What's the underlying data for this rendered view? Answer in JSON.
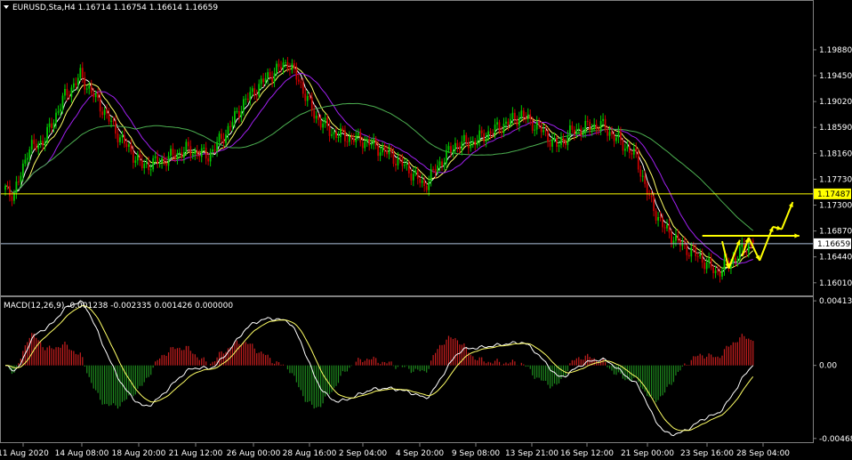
{
  "header": {
    "symbol_line": "EURUSD,Sta,H4  1.16714 1.16754 1.16614 1.16659",
    "macd_line": "MACD(12,26,9) -0.001238 -0.002335 0.001426 0.000000"
  },
  "colors": {
    "background": "#000000",
    "bull_candle": "#00c800",
    "bear_candle": "#c80000",
    "ma_fast": "#ffffff",
    "ma_mid": "#ffff66",
    "ma_slow": "#a020f0",
    "ma_long": "#4caf50",
    "level_line": "#ffff00",
    "price_line": "#b0c4de",
    "macd_pos": "#c81e1e",
    "macd_neg": "#1e8c1e",
    "macd_main": "#ffffff",
    "macd_signal": "#ffff66",
    "annotation": "#ffff00"
  },
  "chart_data": [
    {
      "type": "candlestick",
      "panel": "price",
      "ylim": [
        1.1583,
        1.205
      ],
      "y_ticks": [
        1.1988,
        1.1945,
        1.1902,
        1.1859,
        1.1816,
        1.1773,
        1.173,
        1.1687,
        1.1644,
        1.1601
      ],
      "y_tick_labels": [
        "1.19880",
        "1.19450",
        "1.19020",
        "1.18590",
        "1.18160",
        "1.17730",
        "1.17300",
        "1.16870",
        "1.16440",
        "1.16010"
      ],
      "level_price": 1.17487,
      "level_label": "1.17487",
      "current_price": 1.16659,
      "current_label": "1.16659",
      "x_labels": [
        "11 Aug 2020",
        "14 Aug 08:00",
        "18 Aug 20:00",
        "21 Aug 12:00",
        "26 Aug 00:00",
        "28 Aug 16:00",
        "2 Sep 04:00",
        "4 Sep 20:00",
        "9 Sep 08:00",
        "13 Sep 21:00",
        "16 Sep 12:00",
        "21 Sep 00:00",
        "23 Sep 16:00",
        "28 Sep 04:00"
      ],
      "anchors": [
        [
          0,
          1.176
        ],
        [
          4,
          1.1745
        ],
        [
          10,
          1.182
        ],
        [
          18,
          1.184
        ],
        [
          26,
          1.1905
        ],
        [
          34,
          1.1945
        ],
        [
          44,
          1.189
        ],
        [
          52,
          1.1842
        ],
        [
          62,
          1.1795
        ],
        [
          72,
          1.1805
        ],
        [
          82,
          1.1822
        ],
        [
          92,
          1.1812
        ],
        [
          100,
          1.185
        ],
        [
          108,
          1.19
        ],
        [
          118,
          1.194
        ],
        [
          128,
          1.1968
        ],
        [
          134,
          1.193
        ],
        [
          140,
          1.188
        ],
        [
          148,
          1.185
        ],
        [
          156,
          1.1842
        ],
        [
          164,
          1.1835
        ],
        [
          174,
          1.1815
        ],
        [
          182,
          1.1792
        ],
        [
          190,
          1.1762
        ],
        [
          196,
          1.1795
        ],
        [
          204,
          1.183
        ],
        [
          212,
          1.1835
        ],
        [
          222,
          1.1855
        ],
        [
          234,
          1.188
        ],
        [
          242,
          1.1858
        ],
        [
          250,
          1.1828
        ],
        [
          256,
          1.185
        ],
        [
          262,
          1.1858
        ],
        [
          270,
          1.1863
        ],
        [
          278,
          1.1838
        ],
        [
          286,
          1.181
        ],
        [
          292,
          1.174
        ],
        [
          298,
          1.1695
        ],
        [
          306,
          1.1665
        ],
        [
          316,
          1.164
        ],
        [
          322,
          1.1618
        ],
        [
          328,
          1.1632
        ],
        [
          334,
          1.1655
        ],
        [
          339,
          1.1666
        ]
      ],
      "ma_periods": [
        5,
        10,
        20,
        60
      ],
      "arrows": [
        [
          [
            325,
            1.167
          ],
          [
            328,
            1.1625
          ]
        ],
        [
          [
            328,
            1.1625
          ],
          [
            333,
            1.1672
          ]
        ],
        [
          [
            334,
            1.1645
          ],
          [
            337,
            1.1676
          ]
        ],
        [
          [
            337,
            1.1676
          ],
          [
            342,
            1.1638
          ]
        ],
        [
          [
            342,
            1.1638
          ],
          [
            348,
            1.1694
          ]
        ],
        [
          [
            348,
            1.1694
          ],
          [
            352,
            1.169
          ]
        ],
        [
          [
            352,
            1.169
          ],
          [
            357,
            1.1735
          ]
        ]
      ],
      "hline_annotation": [
        [
          316,
          1.1679
        ],
        [
          360,
          1.1679
        ]
      ]
    },
    {
      "type": "macd",
      "panel": "indicator",
      "params": [
        12,
        26,
        9
      ],
      "ylim": [
        -0.00475,
        0.0042
      ],
      "y_ticks": [
        0.004136,
        0.0,
        -0.004681
      ],
      "y_tick_labels": [
        "0.004136",
        "0.00",
        "-0.004681"
      ],
      "last_values": {
        "main": -0.001238,
        "signal": -0.002335,
        "histogram": 0.001426
      }
    }
  ]
}
